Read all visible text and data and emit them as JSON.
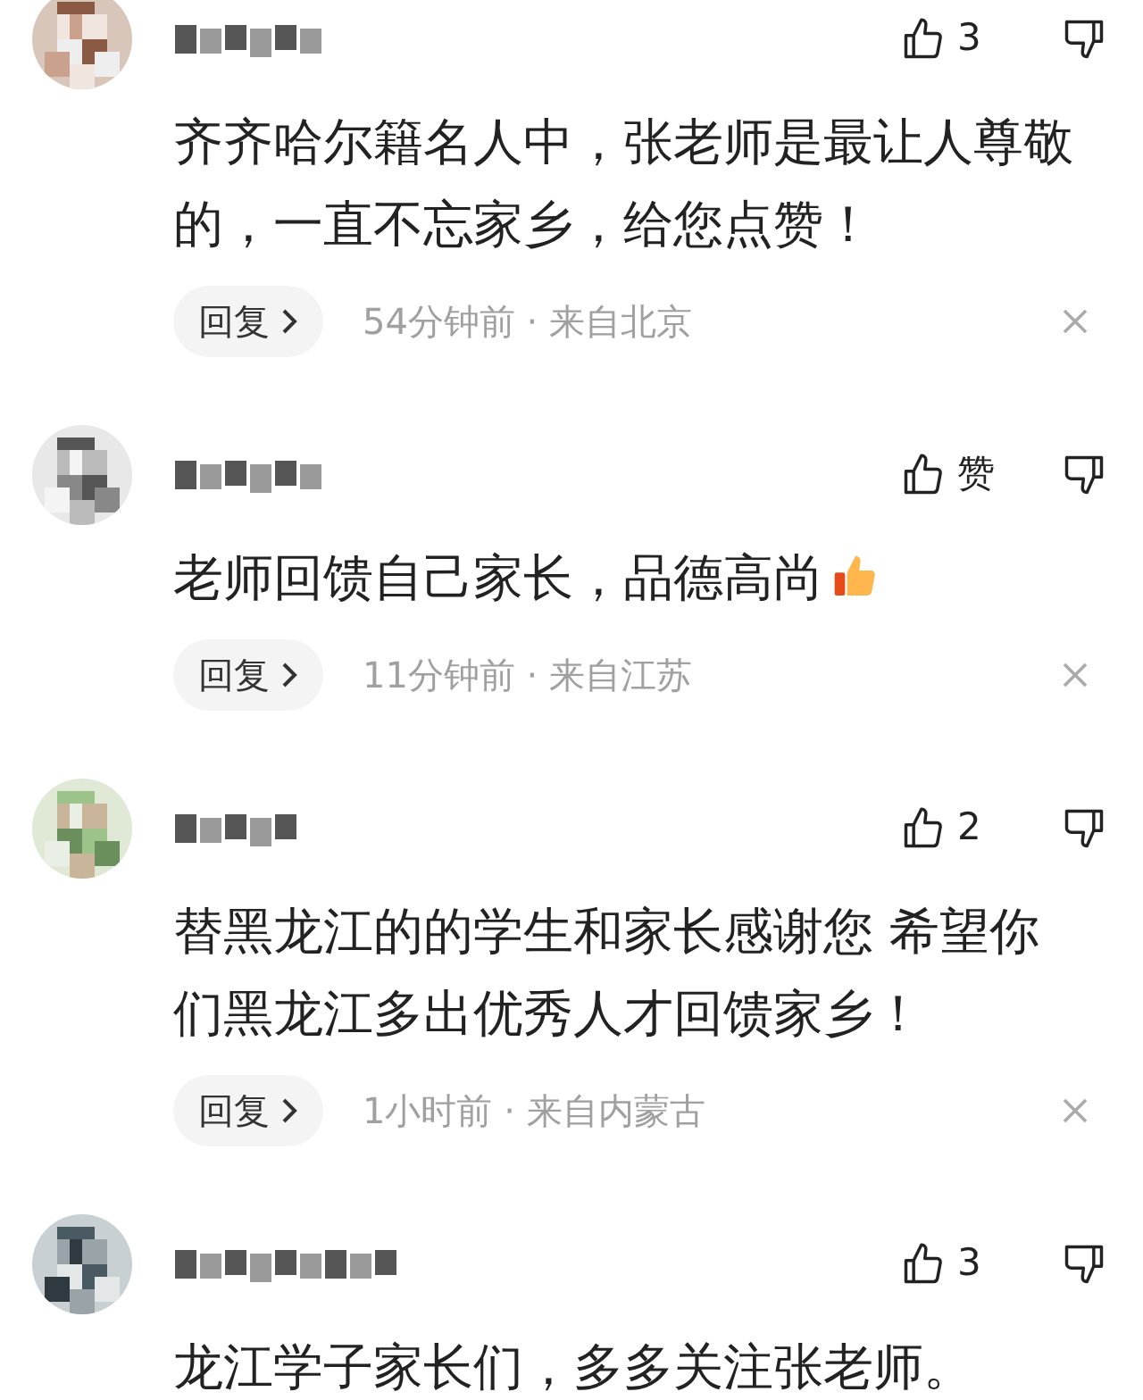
{
  "comments": [
    {
      "likes": "3",
      "text": "齐齐哈尔籍名人中，张老师是最让人尊敬的，一直不忘家乡，给您点赞！",
      "reply": "回复",
      "meta": "54分钟前 · 来自北京"
    },
    {
      "likes": "赞",
      "text": "老师回馈自己家长，品德高尚",
      "thumbs_up_emoji": true,
      "reply": "回复",
      "meta": "11分钟前 · 来自江苏"
    },
    {
      "likes": "2",
      "text": "替黑龙江的的学生和家长感谢您 希望你们黑龙江多出优秀人才回馈家乡！",
      "reply": "回复",
      "meta": "1小时前 · 来自内蒙古"
    },
    {
      "likes": "3",
      "text": "龙江学子家长们，多多关注张老师。"
    }
  ]
}
